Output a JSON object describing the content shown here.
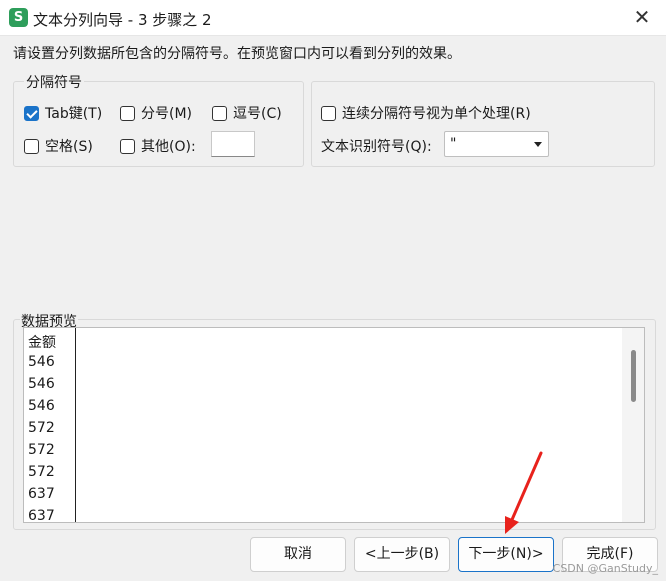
{
  "window": {
    "title": "文本分列向导 - 3 步骤之 2",
    "app_icon_letter": "S"
  },
  "instruction": "请设置分列数据所包含的分隔符号。在预览窗口内可以看到分列的效果。",
  "delimiters": {
    "group_label": "分隔符号",
    "options": [
      {
        "label": "Tab键(T)",
        "checked": true
      },
      {
        "label": "分号(M)",
        "checked": false
      },
      {
        "label": "逗号(C)",
        "checked": false
      },
      {
        "label": "空格(S)",
        "checked": false
      },
      {
        "label": "其他(O):",
        "checked": false
      }
    ],
    "other_value": ""
  },
  "right_options": {
    "consecutive_label": "连续分隔符号视为单个处理(R)",
    "consecutive_checked": false,
    "qualifier_label": "文本识别符号(Q):",
    "qualifier_value": "\""
  },
  "preview": {
    "label": "数据预览",
    "rows": [
      "金额",
      "546",
      "546",
      "546",
      "572",
      "572",
      "572",
      "637",
      "637"
    ]
  },
  "buttons": {
    "cancel": "取消",
    "back": "<上一步(B)",
    "next": "下一步(N)>",
    "finish": "完成(F)"
  },
  "colors": {
    "accent": "#1a73c9",
    "app_icon": "#2e9e5b",
    "arrow": "#e8221c"
  },
  "watermark": "CSDN @GanStudy_"
}
